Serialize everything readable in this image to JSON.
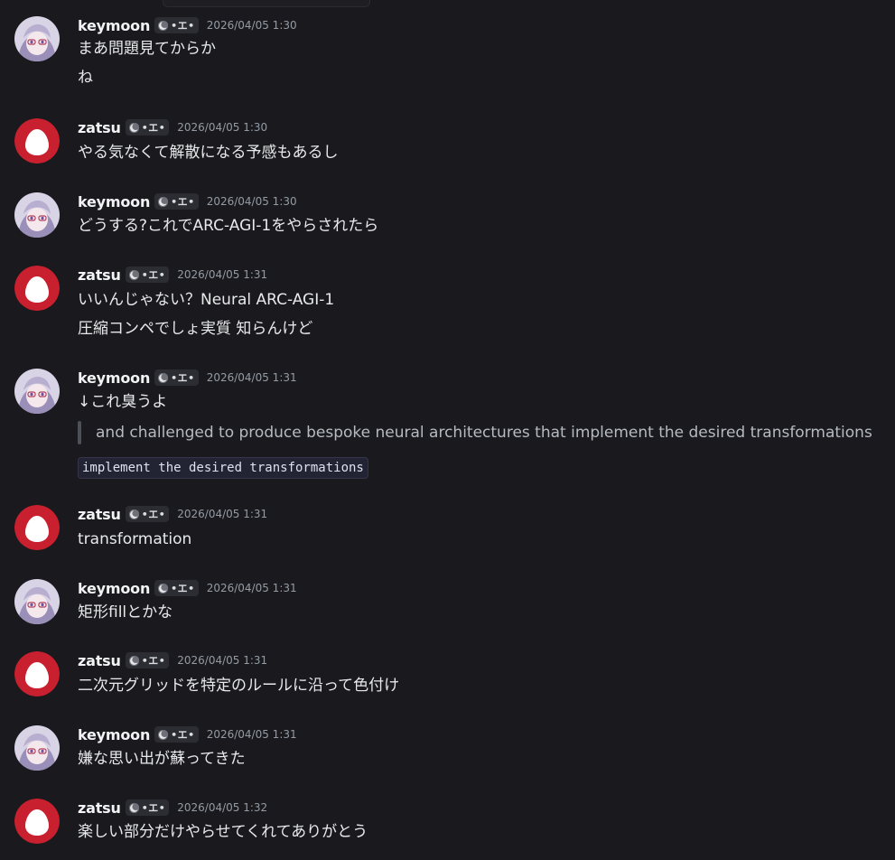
{
  "badge_label": "•エ•",
  "messages": [
    {
      "author": "keymoon",
      "time": "2026/04/05 1:30",
      "lines": [
        "まあ問題見てからか",
        "ね"
      ]
    },
    {
      "author": "zatsu",
      "time": "2026/04/05 1:30",
      "lines": [
        "やる気なくて解散になる予感もあるし"
      ]
    },
    {
      "author": "keymoon",
      "time": "2026/04/05 1:30",
      "lines": [
        "どうする?これでARC-AGI-1をやらされたら"
      ]
    },
    {
      "author": "zatsu",
      "time": "2026/04/05 1:31",
      "lines": [
        "いいんじゃない？Neural ARC-AGI-1",
        "圧縮コンペでしょ実質 知らんけど"
      ]
    },
    {
      "author": "keymoon",
      "time": "2026/04/05 1:31",
      "lines": [
        "↓これ臭うよ"
      ],
      "quote": "and challenged to produce bespoke neural architectures that implement the desired transformations",
      "code": "implement the desired transformations"
    },
    {
      "author": "zatsu",
      "time": "2026/04/05 1:31",
      "lines": [
        "transformation"
      ]
    },
    {
      "author": "keymoon",
      "time": "2026/04/05 1:31",
      "lines": [
        "矩形fillとかな"
      ]
    },
    {
      "author": "zatsu",
      "time": "2026/04/05 1:31",
      "lines": [
        "二次元グリッドを特定のルールに沿って色付け"
      ]
    },
    {
      "author": "keymoon",
      "time": "2026/04/05 1:31",
      "lines": [
        "嫌な思い出が蘇ってきた"
      ]
    },
    {
      "author": "zatsu",
      "time": "2026/04/05 1:32",
      "lines": [
        "楽しい部分だけやらせてくれてありがとう"
      ]
    }
  ],
  "colors": {
    "background": "#1a1a1e",
    "zatsu_avatar": "#c8202e",
    "timestamp": "#949ba4"
  }
}
